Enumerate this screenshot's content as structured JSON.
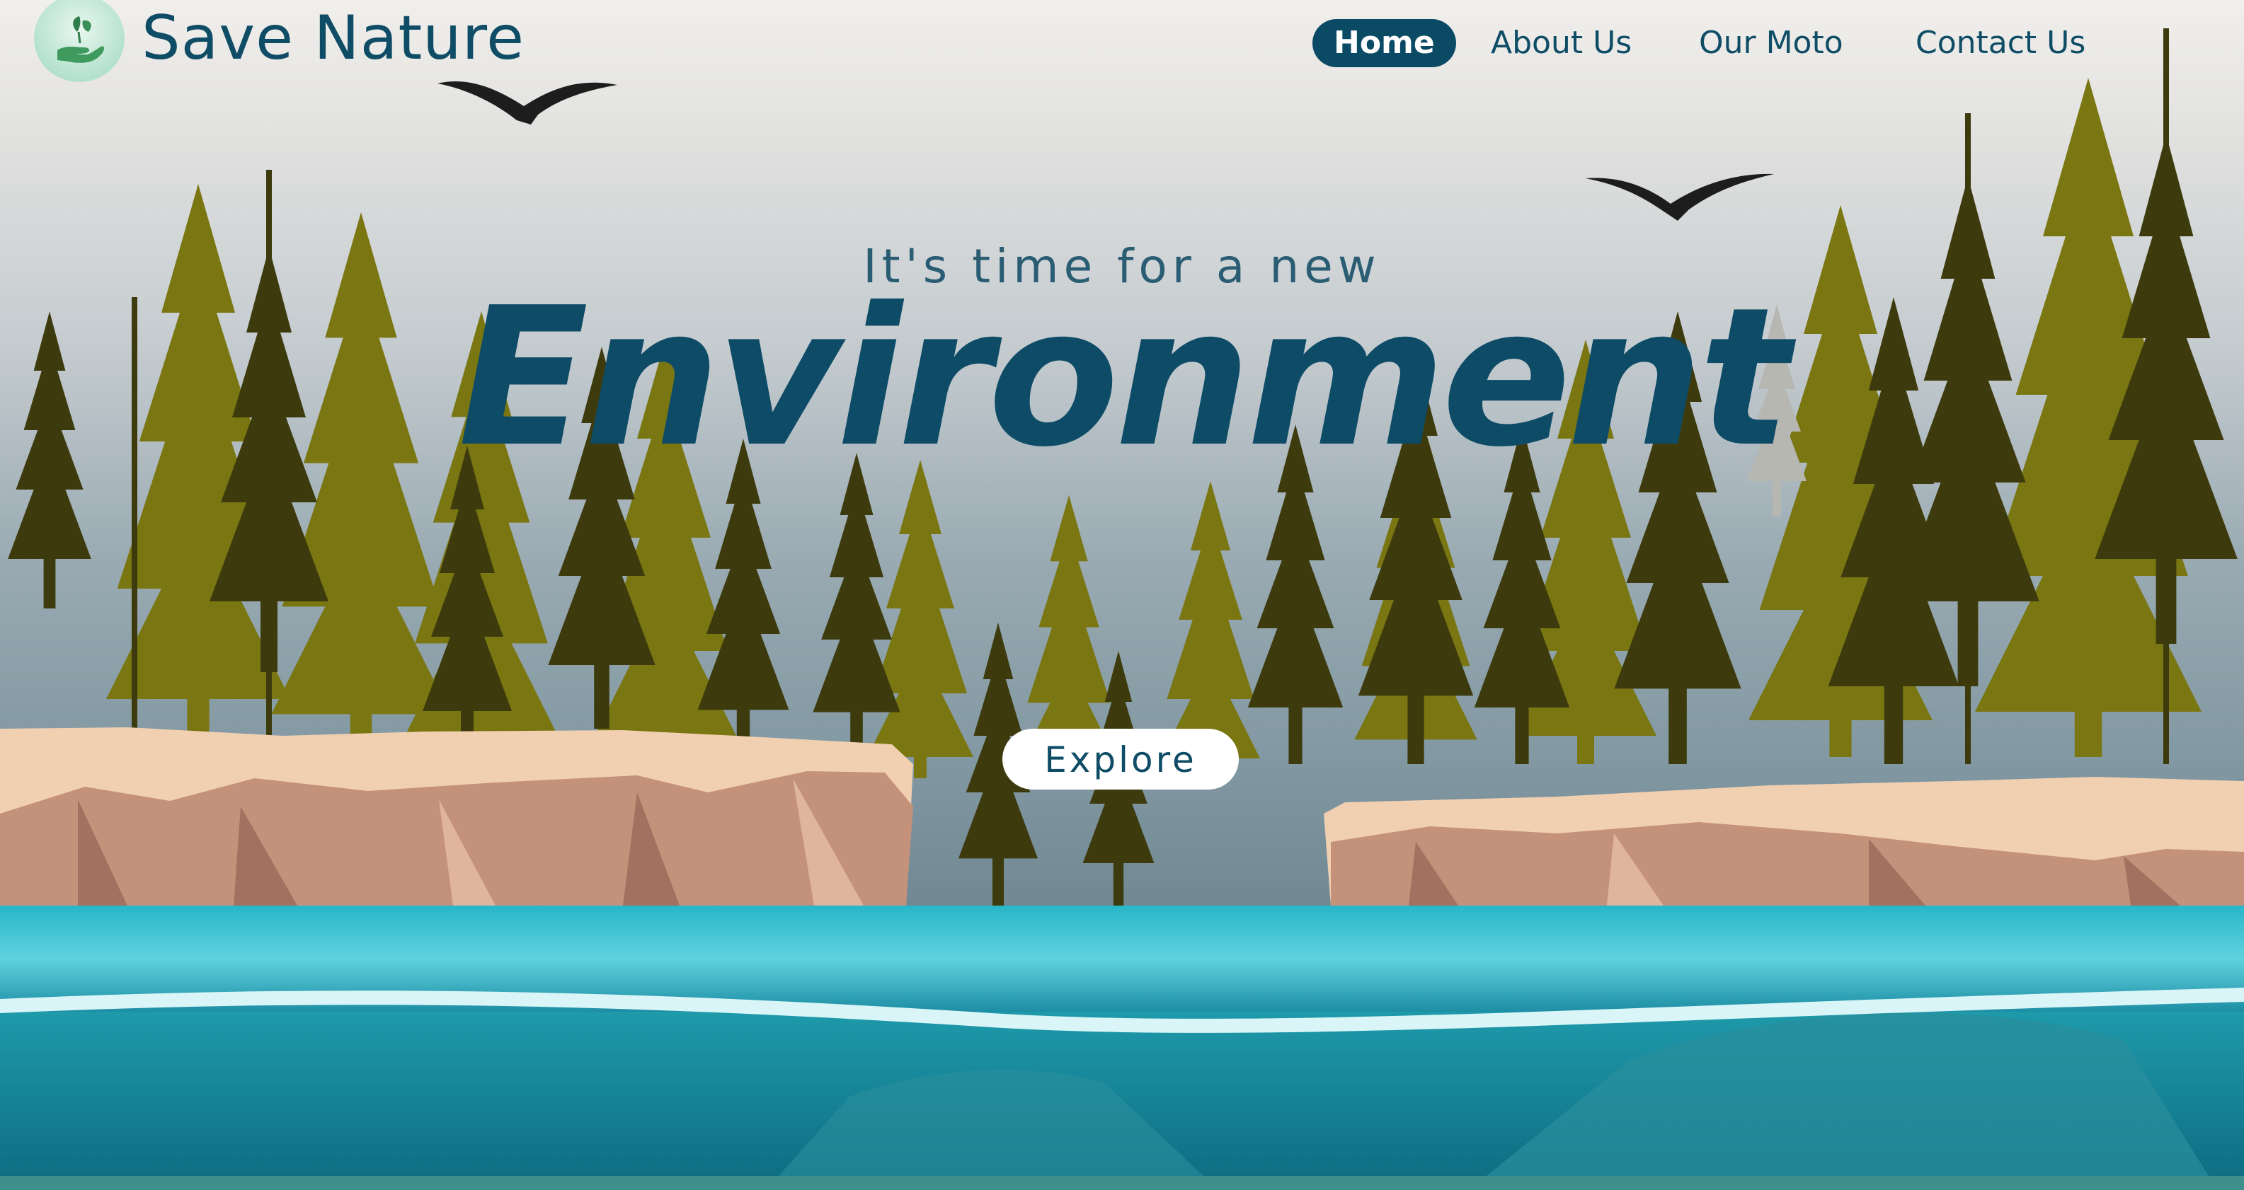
{
  "header": {
    "brand": "Save Nature",
    "logo_icon": "hand-leaf-icon"
  },
  "nav": {
    "items": [
      {
        "label": "Home",
        "active": true
      },
      {
        "label": "About Us",
        "active": false
      },
      {
        "label": "Our Moto",
        "active": false
      },
      {
        "label": "Contact Us",
        "active": false
      }
    ]
  },
  "hero": {
    "tagline": "It's time for a new",
    "headline": "Environment",
    "cta_label": "Explore"
  },
  "colors": {
    "brand": "#0f4c66",
    "active_nav_bg": "#0b4a64",
    "forest_dark": "#3a3a0c",
    "forest_olive": "#77720f",
    "cliff": "#c8917a",
    "water": "#1fa7b6"
  },
  "decor_icons": [
    "bird-icon",
    "pine-tree-icon",
    "cliff-shape",
    "water-wave"
  ]
}
